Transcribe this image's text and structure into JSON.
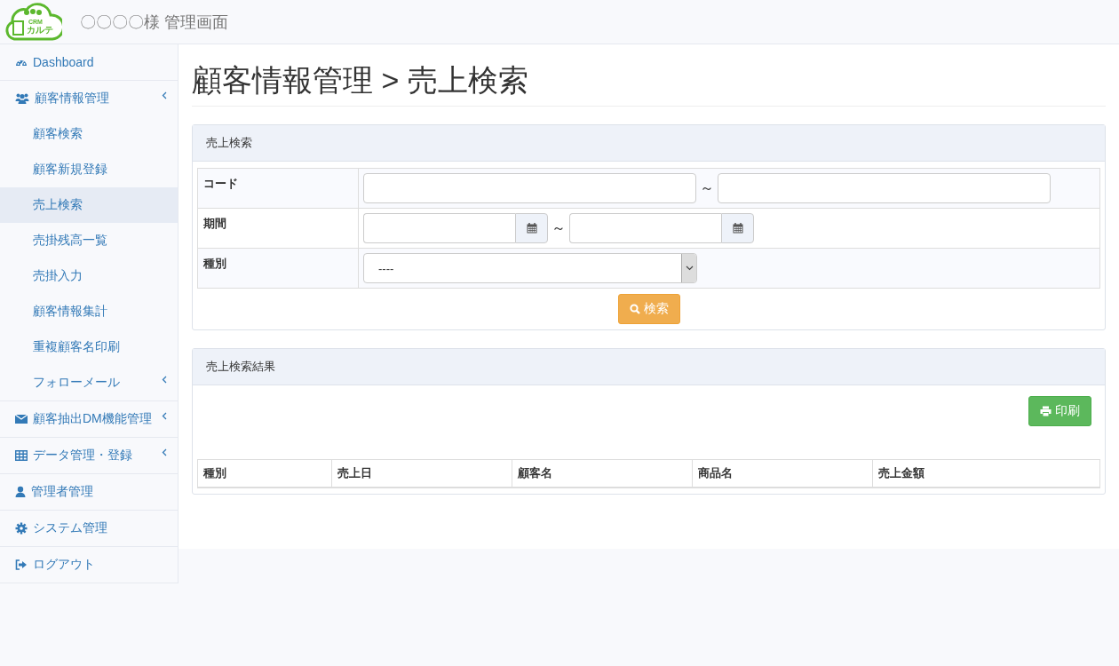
{
  "header": {
    "logo": {
      "small": "CRM",
      "text": "カルテ"
    },
    "title": "〇〇〇〇様 管理画面"
  },
  "sidebar": {
    "items": [
      {
        "label": "Dashboard",
        "selected": false,
        "expandable": false
      },
      {
        "label": "顧客情報管理",
        "selected": false,
        "expandable": true,
        "children": [
          {
            "label": "顧客検索",
            "selected": false,
            "expandable": false
          },
          {
            "label": "顧客新規登録",
            "selected": false,
            "expandable": false
          },
          {
            "label": "売上検索",
            "selected": true,
            "expandable": false
          },
          {
            "label": "売掛残高一覧",
            "selected": false,
            "expandable": false
          },
          {
            "label": "売掛入力",
            "selected": false,
            "expandable": false
          },
          {
            "label": "顧客情報集計",
            "selected": false,
            "expandable": false
          },
          {
            "label": "重複顧客名印刷",
            "selected": false,
            "expandable": false
          },
          {
            "label": "フォローメール",
            "selected": false,
            "expandable": true
          }
        ]
      },
      {
        "label": "顧客抽出DM機能管理",
        "selected": false,
        "expandable": true
      },
      {
        "label": "データ管理・登録",
        "selected": false,
        "expandable": true
      },
      {
        "label": "管理者管理",
        "selected": false,
        "expandable": false
      },
      {
        "label": "システム管理",
        "selected": false,
        "expandable": false
      },
      {
        "label": "ログアウト",
        "selected": false,
        "expandable": false
      }
    ]
  },
  "page_title": "顧客情報管理 > 売上検索",
  "search_panel": {
    "title": "売上検索",
    "rows": [
      {
        "label": "コード",
        "kind": "text_range",
        "separator": "～"
      },
      {
        "label": "期間",
        "kind": "date_range",
        "separator": "～"
      },
      {
        "label": "種別",
        "kind": "select",
        "value": "----"
      }
    ],
    "button": "検索"
  },
  "results_panel": {
    "title": "売上検索結果",
    "button": "印刷",
    "columns": [
      "種別",
      "売上日",
      "顧客名",
      "商品名",
      "売上金額"
    ]
  }
}
